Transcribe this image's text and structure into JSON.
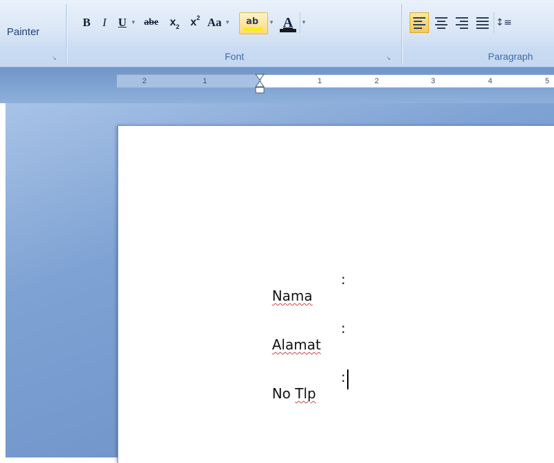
{
  "ribbon": {
    "clipboard": {
      "painter_label": "Painter"
    },
    "font_group": {
      "label": "Font",
      "buttons": {
        "bold": "B",
        "italic": "I",
        "underline": "U",
        "strikethrough": "abe",
        "subscript": "x",
        "subscript_mark": "2",
        "superscript": "x",
        "superscript_mark": "2",
        "change_case": "Aa",
        "highlight": "ab",
        "font_color": "A"
      },
      "colors": {
        "highlight": "#f7ec1f",
        "font_color": "#1a1a1a"
      }
    },
    "paragraph_group": {
      "label": "Paragraph"
    }
  },
  "ruler": {
    "ticks": [
      "2",
      "1",
      "1",
      "2",
      "3",
      "4",
      "5"
    ]
  },
  "document": {
    "lines": [
      {
        "label": "Nama",
        "colon": ":"
      },
      {
        "label": "Alamat",
        "colon": ":"
      },
      {
        "label_part1": "No",
        "label_part2": "Tlp",
        "colon": ":"
      }
    ]
  }
}
